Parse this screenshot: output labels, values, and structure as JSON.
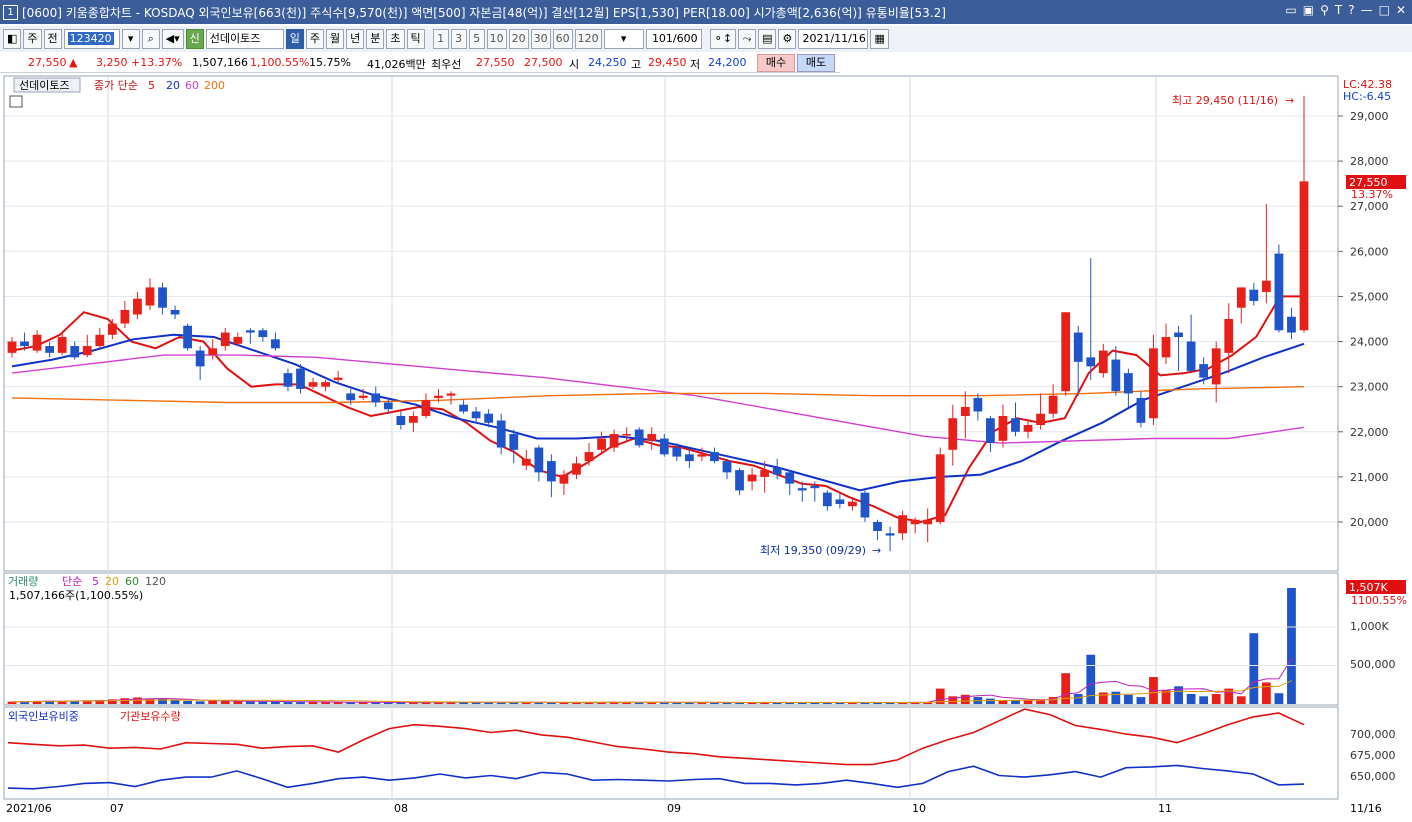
{
  "window": {
    "screen_no": "1",
    "title": "[0600] 키움종합차트 - KOSDAQ 외국인보유[663(천)] 주식수[9,570(천)] 액면[500] 자본금[48(억)] 결산[12월] EPS[1,530] PER[18.00] 시가총액[2,636(억)] 유통비율[53.2]",
    "title_icons": [
      "window-icon",
      "window-icon",
      "pin-icon",
      "text-icon",
      "help-icon",
      "minimize-icon",
      "maximize-icon",
      "close-icon"
    ]
  },
  "toolbar": {
    "period_type": "주",
    "prev_label": "전",
    "stock_code": "123420",
    "stock_badge": "신",
    "stock_name": "선데이토즈",
    "periods": [
      "일",
      "주",
      "월",
      "년",
      "분",
      "초",
      "틱"
    ],
    "active_period": "일",
    "intervals": [
      "1",
      "3",
      "5",
      "10",
      "20",
      "30",
      "60",
      "120"
    ],
    "count": "101/600",
    "date": "2021/11/16"
  },
  "quote": {
    "price": "27,550",
    "change_arrow": "▲",
    "change": "3,250",
    "change_pct": "+13.37%",
    "volume": "1,507,166",
    "volume_pct": "1,100.55%",
    "turnover": "15.75%",
    "amount": "41,026백만",
    "best_label": "최우선",
    "best_ask": "27,550",
    "best_bid": "27,500",
    "open_label": "시",
    "open": "24,250",
    "high_label": "고",
    "high": "29,450",
    "low_label": "저",
    "low": "24,200",
    "buy_label": "매수",
    "sell_label": "매도"
  },
  "price_panel": {
    "stock_tag": "선데이토즈",
    "legend_prefix": "종가 단순",
    "ma_labels": [
      "5",
      "20",
      "60",
      "200"
    ],
    "ma_colors": [
      "#e01010",
      "#1030c8",
      "#d040d0",
      "#f07010"
    ],
    "lc_label": "LC:42.38",
    "hc_label": "HC:-6.45",
    "high_annotation": "최고 29,450 (11/16)",
    "low_annotation": "최저 19,350 (09/29)",
    "price_tag": "27,550",
    "pct_tag": "13.37%",
    "y_ticks": [
      "29,000",
      "28,000",
      "27,000",
      "26,000",
      "25,000",
      "24,000",
      "23,000",
      "22,000",
      "21,000",
      "20,000"
    ]
  },
  "volume_panel": {
    "legend_title": "거래량",
    "legend_prefix": "단순",
    "ma_labels": [
      "5",
      "20",
      "60",
      "120"
    ],
    "ma_colors": [
      "#c020c0",
      "#e0a000",
      "#2a8a2a",
      "#555555"
    ],
    "info": "1,507,166주(1,100.55%)",
    "tag_value": "1,507K",
    "tag_pct": "1100.55%",
    "y_ticks": [
      "1,000K",
      "500,000"
    ]
  },
  "holdings_panel": {
    "foreign_label": "외국인보유비중",
    "institution_label": "기관보유수량",
    "y_ticks": [
      "700,000",
      "675,000",
      "650,000"
    ]
  },
  "x_axis": {
    "labels": [
      "2021/06",
      "07",
      "08",
      "09",
      "10",
      "11"
    ],
    "right_label": "11/16"
  },
  "chart_data": {
    "type": "candlestick",
    "dates_note": "daily candles 2021/06 - 2021/11/16",
    "ylim": [
      19300,
      29450
    ],
    "candles": [
      [
        23750,
        24000,
        24100,
        23650
      ],
      [
        24000,
        23900,
        24200,
        23800
      ],
      [
        23800,
        24150,
        24250,
        23750
      ],
      [
        23900,
        23750,
        24000,
        23650
      ],
      [
        23750,
        24100,
        24200,
        23700
      ],
      [
        23900,
        23650,
        24000,
        23600
      ],
      [
        23700,
        23900,
        24150,
        23650
      ],
      [
        23900,
        24150,
        24300,
        23850
      ],
      [
        24150,
        24400,
        24500,
        24050
      ],
      [
        24400,
        24700,
        24900,
        24300
      ],
      [
        24600,
        24950,
        25100,
        24500
      ],
      [
        24800,
        25200,
        25400,
        24700
      ],
      [
        25200,
        24750,
        25300,
        24600
      ],
      [
        24700,
        24600,
        24800,
        24500
      ],
      [
        24350,
        23850,
        24400,
        23800
      ],
      [
        23800,
        23450,
        23900,
        23150
      ],
      [
        23700,
        23850,
        24050,
        23600
      ],
      [
        23900,
        24200,
        24300,
        23800
      ],
      [
        23950,
        24100,
        24200,
        23900
      ],
      [
        24250,
        24200,
        24300,
        23950
      ],
      [
        24250,
        24100,
        24300,
        24000
      ],
      [
        24050,
        23850,
        24200,
        23800
      ],
      [
        23300,
        23000,
        23400,
        22900
      ],
      [
        23400,
        22950,
        23500,
        22850
      ],
      [
        23000,
        23100,
        23200,
        22950
      ],
      [
        23000,
        23100,
        23150,
        22900
      ],
      [
        23150,
        23200,
        23350,
        23100
      ],
      [
        22850,
        22700,
        22950,
        22600
      ],
      [
        22750,
        22800,
        22950,
        22700
      ],
      [
        22850,
        22650,
        23000,
        22550
      ],
      [
        22650,
        22500,
        22750,
        22400
      ],
      [
        22350,
        22150,
        22450,
        22050
      ],
      [
        22200,
        22350,
        22450,
        22000
      ],
      [
        22350,
        22700,
        22850,
        22300
      ],
      [
        22750,
        22800,
        22950,
        22650
      ],
      [
        22800,
        22850,
        22900,
        22600
      ],
      [
        22600,
        22450,
        22700,
        22400
      ],
      [
        22450,
        22300,
        22550,
        22200
      ],
      [
        22400,
        22200,
        22500,
        22100
      ],
      [
        22250,
        21650,
        22400,
        21500
      ],
      [
        21950,
        21600,
        22050,
        21300
      ],
      [
        21250,
        21400,
        21600,
        21150
      ],
      [
        21650,
        21100,
        21700,
        20900
      ],
      [
        21350,
        20900,
        21500,
        20550
      ],
      [
        20850,
        21050,
        21150,
        20600
      ],
      [
        21050,
        21300,
        21450,
        20950
      ],
      [
        21350,
        21550,
        21750,
        21250
      ],
      [
        21600,
        21850,
        22000,
        21500
      ],
      [
        21650,
        21950,
        22050,
        21550
      ],
      [
        21950,
        21950,
        22100,
        21800
      ],
      [
        22050,
        21700,
        22100,
        21650
      ],
      [
        21800,
        21950,
        22100,
        21600
      ],
      [
        21850,
        21500,
        21950,
        21450
      ],
      [
        21650,
        21450,
        21750,
        21350
      ],
      [
        21500,
        21350,
        21650,
        21200
      ],
      [
        21450,
        21500,
        21650,
        21350
      ],
      [
        21550,
        21350,
        21650,
        21300
      ],
      [
        21350,
        21100,
        21400,
        20950
      ],
      [
        21150,
        20700,
        21200,
        20600
      ],
      [
        20900,
        21050,
        21200,
        20700
      ],
      [
        21000,
        21150,
        21350,
        20650
      ],
      [
        21200,
        21050,
        21400,
        20950
      ],
      [
        21100,
        20850,
        21150,
        20600
      ],
      [
        20750,
        20700,
        20900,
        20450
      ],
      [
        20800,
        20750,
        20900,
        20450
      ],
      [
        20650,
        20350,
        20700,
        20250
      ],
      [
        20500,
        20400,
        20650,
        20300
      ],
      [
        20350,
        20450,
        20550,
        20250
      ],
      [
        20650,
        20100,
        20700,
        20000
      ],
      [
        20000,
        19800,
        20050,
        19600
      ],
      [
        19750,
        19700,
        19900,
        19350
      ],
      [
        19750,
        20150,
        20250,
        19600
      ],
      [
        19950,
        20050,
        20100,
        19750
      ],
      [
        19950,
        20050,
        20300,
        19550
      ],
      [
        20000,
        21500,
        21650,
        19950
      ],
      [
        21600,
        22300,
        22600,
        21250
      ],
      [
        22350,
        22550,
        22900,
        21850
      ],
      [
        22750,
        22450,
        22850,
        22250
      ],
      [
        22300,
        21750,
        22350,
        21550
      ],
      [
        21800,
        22350,
        22600,
        21650
      ],
      [
        22300,
        22000,
        22650,
        21900
      ],
      [
        22000,
        22150,
        22250,
        21850
      ],
      [
        22150,
        22400,
        22850,
        22050
      ],
      [
        22400,
        22800,
        23050,
        22300
      ],
      [
        22900,
        24650,
        24650,
        22800
      ],
      [
        24200,
        23550,
        24350,
        22800
      ],
      [
        23650,
        23450,
        25850,
        23150
      ],
      [
        23300,
        23800,
        23950,
        23200
      ],
      [
        23600,
        22900,
        23900,
        22800
      ],
      [
        23300,
        22850,
        23400,
        22550
      ],
      [
        22750,
        22200,
        22900,
        22100
      ],
      [
        22300,
        23850,
        24150,
        22150
      ],
      [
        23650,
        24100,
        24400,
        23500
      ],
      [
        24200,
        24100,
        24350,
        23350
      ],
      [
        24000,
        23350,
        24600,
        23300
      ],
      [
        23500,
        23200,
        23650,
        23050
      ],
      [
        23050,
        23850,
        24000,
        22650
      ],
      [
        23750,
        24500,
        24850,
        23300
      ],
      [
        24750,
        25200,
        25200,
        24400
      ],
      [
        25150,
        24900,
        25300,
        24800
      ],
      [
        25100,
        25350,
        27050,
        24850
      ],
      [
        25950,
        24250,
        26150,
        24200
      ],
      [
        24550,
        24200,
        24750,
        24050
      ],
      [
        24250,
        27550,
        29450,
        24200
      ]
    ],
    "volume_series_k": [
      30,
      30,
      40,
      45,
      40,
      40,
      45,
      50,
      60,
      75,
      85,
      70,
      65,
      50,
      40,
      35,
      40,
      40,
      35,
      35,
      30,
      30,
      25,
      25,
      30,
      25,
      20,
      20,
      20,
      20,
      25,
      20,
      20,
      25,
      30,
      20,
      20,
      20,
      25,
      25,
      20,
      20,
      20,
      20,
      20,
      20,
      20,
      25,
      30,
      20,
      20,
      25,
      20,
      20,
      20,
      20,
      20,
      20,
      20,
      20,
      20,
      20,
      20,
      20,
      20,
      20,
      20,
      20,
      20,
      20,
      20,
      20,
      25,
      25,
      200,
      100,
      120,
      90,
      70,
      50,
      50,
      50,
      60,
      90,
      400,
      130,
      640,
      150,
      160,
      120,
      90,
      350,
      180,
      230,
      130,
      100,
      130,
      200,
      100,
      920,
      280,
      140,
      1507
    ],
    "ma_series": [
      {
        "name": "5",
        "values": [
          23800,
          23900,
          24150,
          24650,
          24500,
          24000,
          23850,
          24100,
          24000,
          23400,
          23000,
          23050,
          23050,
          22800,
          22550,
          22350,
          22450,
          22550,
          22500,
          22200,
          21800,
          21550,
          21150,
          21000,
          21300,
          21650,
          21850,
          21700,
          21650,
          21500,
          21350,
          21250,
          21050,
          20850,
          20800,
          20550,
          20350,
          20100,
          20000,
          20150,
          21200,
          22000,
          22300,
          22200,
          22300,
          23300,
          23800,
          23700,
          23250,
          23300,
          23400,
          23700,
          24100,
          25000,
          25000
        ]
      },
      {
        "name": "20",
        "values": [
          23450,
          23600,
          23800,
          24050,
          24150,
          24100,
          23800,
          23500,
          23100,
          22800,
          22600,
          22300,
          22100,
          21850,
          21850,
          21900,
          21800,
          21600,
          21400,
          21200,
          20950,
          20700,
          20900,
          21000,
          21050,
          21350,
          21800,
          22200,
          22700,
          23000,
          23300,
          23650,
          23950
        ]
      },
      {
        "name": "60",
        "values": [
          23300,
          23500,
          23700,
          23700,
          23650,
          23500,
          23350,
          23200,
          23000,
          22800,
          22500,
          22200,
          21900,
          21750,
          21800,
          21850,
          21850,
          22100
        ]
      },
      {
        "name": "200",
        "values": [
          22750,
          22700,
          22650,
          22650,
          22700,
          22800,
          22850,
          22850,
          22800,
          22800,
          22850,
          22950,
          23000
        ]
      }
    ]
  }
}
